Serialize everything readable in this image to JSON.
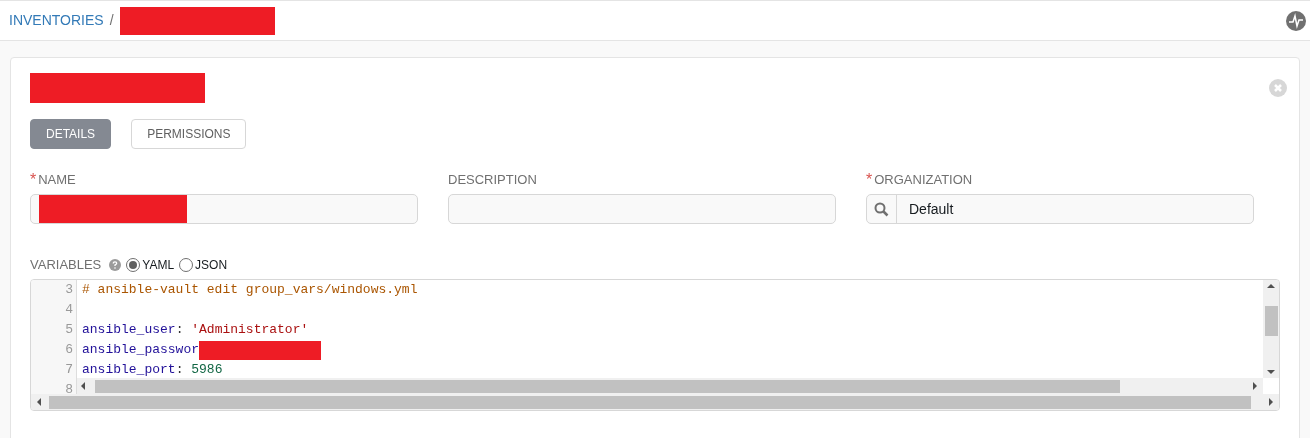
{
  "breadcrumb": {
    "items": [
      {
        "label": "INVENTORIES"
      }
    ],
    "separator": "/"
  },
  "tabs": [
    {
      "label": "DETAILS",
      "selected": true
    },
    {
      "label": "PERMISSIONS",
      "selected": false
    }
  ],
  "fields": [
    {
      "label": "NAME",
      "required_mark": "*"
    },
    {
      "label": "DESCRIPTION"
    },
    {
      "label": "ORGANIZATION",
      "required_mark": "*",
      "value": "Default",
      "lookup": true
    }
  ],
  "variables": {
    "label": "VARIABLES",
    "formats": [
      {
        "label": "YAML",
        "selected": true
      },
      {
        "label": "JSON",
        "selected": false
      }
    ],
    "lines": [
      {
        "number": "3",
        "tokens": [
          {
            "kind": "comment",
            "text": "# ansible-vault edit group_vars/windows.yml"
          }
        ]
      },
      {
        "number": "4"
      },
      {
        "number": "5",
        "tokens": [
          {
            "kind": "key",
            "text": "ansible_user"
          },
          {
            "kind": "plain",
            "text": ": "
          },
          {
            "kind": "string",
            "text": "'Administrator'"
          }
        ]
      },
      {
        "number": "6",
        "tokens": [
          {
            "kind": "key",
            "text": "ansible_passwor"
          }
        ],
        "redacted": true
      },
      {
        "number": "7",
        "tokens": [
          {
            "kind": "key",
            "text": "ansible_port"
          },
          {
            "kind": "plain",
            "text": ": "
          },
          {
            "kind": "number",
            "text": "5986"
          }
        ]
      },
      {
        "number": "8"
      }
    ]
  }
}
